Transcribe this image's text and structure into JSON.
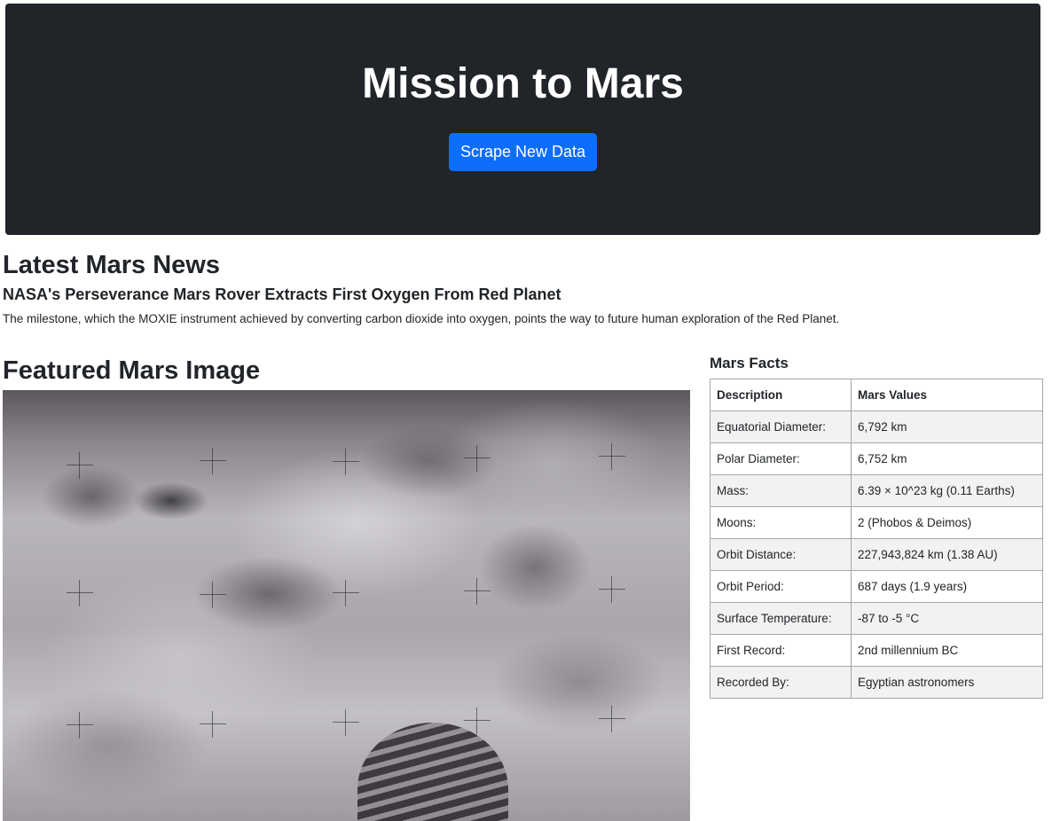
{
  "header": {
    "title": "Mission to Mars",
    "scrape_button_label": "Scrape New Data"
  },
  "news": {
    "heading": "Latest Mars News",
    "title": "NASA's Perseverance Mars Rover Extracts First Oxygen From Red Planet",
    "paragraph": "The milestone, which the MOXIE instrument achieved by converting carbon dioxide into oxygen, points the way to future human exploration of the Red Planet."
  },
  "featured": {
    "heading": "Featured Mars Image",
    "image_alt": "Featured Mars Image"
  },
  "facts": {
    "heading": "Mars Facts",
    "columns": [
      "Description",
      "Mars Values"
    ],
    "rows": [
      [
        "Equatorial Diameter:",
        "6,792 km"
      ],
      [
        "Polar Diameter:",
        "6,752 km"
      ],
      [
        "Mass:",
        "6.39 × 10^23 kg (0.11 Earths)"
      ],
      [
        "Moons:",
        "2 (Phobos & Deimos)"
      ],
      [
        "Orbit Distance:",
        "227,943,824 km (1.38 AU)"
      ],
      [
        "Orbit Period:",
        "687 days (1.9 years)"
      ],
      [
        "Surface Temperature:",
        "-87 to -5 °C"
      ],
      [
        "First Record:",
        "2nd millennium BC"
      ],
      [
        "Recorded By:",
        "Egyptian astronomers"
      ]
    ]
  },
  "colors": {
    "jumbotron_bg": "#212529",
    "button_bg": "#0d6efd",
    "table_stripe": "#f2f2f2"
  }
}
